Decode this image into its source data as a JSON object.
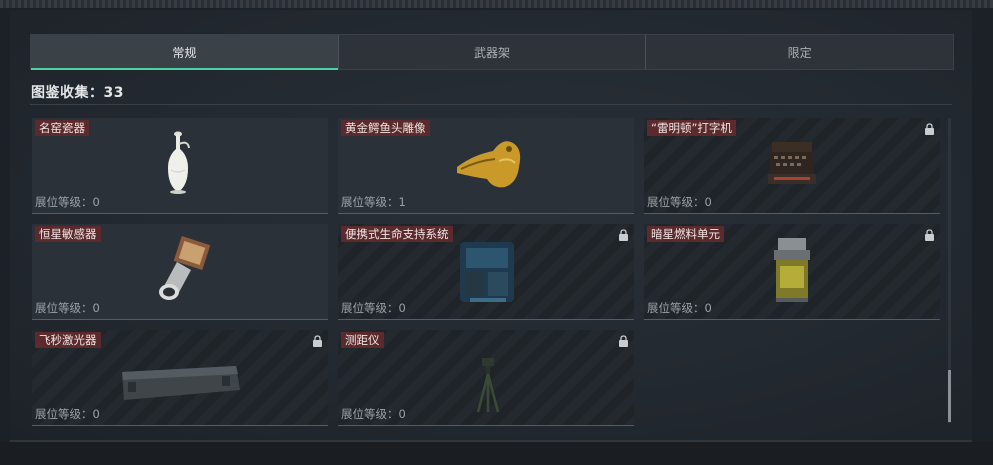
{
  "tabs": [
    {
      "label": "常规"
    },
    {
      "label": "武器架"
    },
    {
      "label": "限定"
    }
  ],
  "collection_label": "图鉴收集：33",
  "items": [
    {
      "name": "名窑瓷器",
      "level": "展位等级：0",
      "locked": false,
      "icon": "porcelain-vase-icon"
    },
    {
      "name": "黄金鳄鱼头雕像",
      "level": "展位等级：1",
      "locked": false,
      "icon": "golden-crocodile-head-icon"
    },
    {
      "name": "“雷明顿”打字机",
      "level": "展位等级：0",
      "locked": true,
      "icon": "typewriter-icon"
    },
    {
      "name": "恒星敏感器",
      "level": "展位等级：0",
      "locked": false,
      "icon": "star-sensor-icon"
    },
    {
      "name": "便携式生命支持系统",
      "level": "展位等级：0",
      "locked": true,
      "icon": "life-support-system-icon"
    },
    {
      "name": "暗星燃料单元",
      "level": "展位等级：0",
      "locked": true,
      "icon": "fuel-cell-icon"
    },
    {
      "name": "飞秒激光器",
      "level": "展位等级：0",
      "locked": true,
      "icon": "femtosecond-laser-icon"
    },
    {
      "name": "测距仪",
      "level": "展位等级：0",
      "locked": true,
      "icon": "rangefinder-tripod-icon"
    }
  ],
  "colors": {
    "accent": "#4fd1a5",
    "name_tag": "#5a2a2c"
  }
}
